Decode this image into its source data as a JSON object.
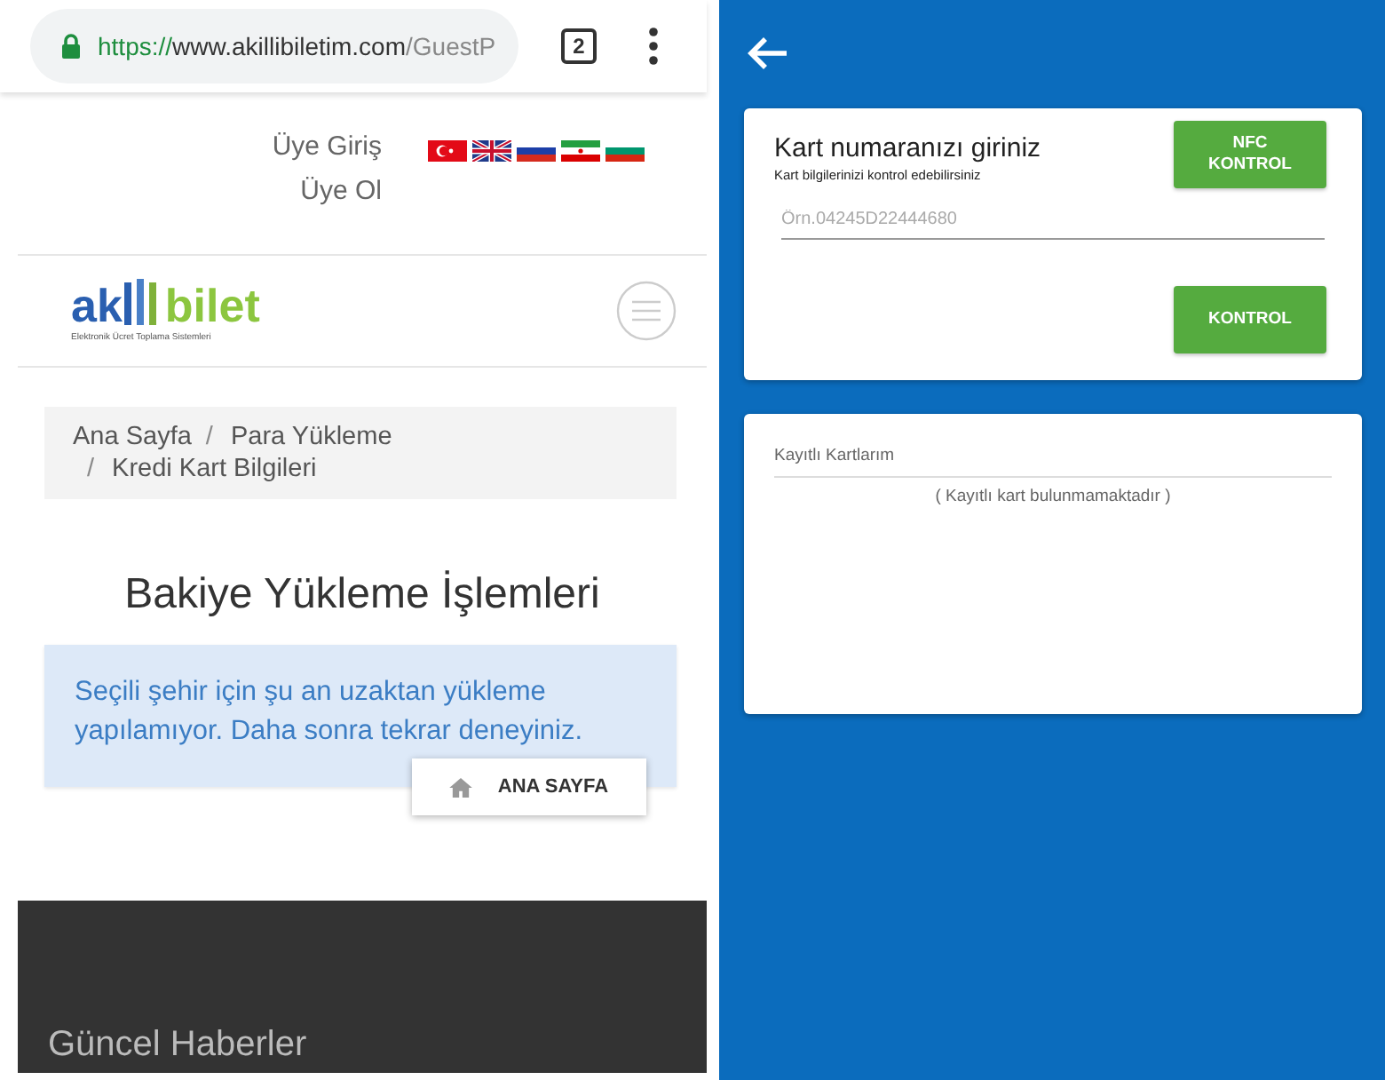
{
  "browser": {
    "url": {
      "scheme": "https://",
      "host": "www.akillibiletim.com",
      "path": "/GuestP"
    },
    "tab_count": "2"
  },
  "website": {
    "member_links": [
      "Üye Giriş",
      "Üye Ol"
    ],
    "logo": {
      "left": "ak",
      "right": "bilet",
      "tagline": "Elektronik Ücret Toplama Sistemleri"
    },
    "breadcrumb": [
      {
        "label": "Ana Sayfa"
      },
      {
        "separator": "/",
        "label": "Para Yükleme"
      },
      {
        "separator": "/",
        "label": "Kredi Kart Bilgileri"
      }
    ],
    "heading": "Bakiye Yükleme İşlemleri",
    "alert": "Seçili şehir için şu an uzaktan yükleme yapılamıyor. Daha sonra tekrar deneyiniz.",
    "home_button": "ANA SAYFA",
    "footer_title": "Güncel Haberler"
  },
  "app": {
    "card_entry": {
      "title": "Kart numaranızı giriniz",
      "subtitle": "Kart bilgilerinizi kontrol edebilirsiniz",
      "nfc_button": "NFC KONTROL",
      "placeholder": "Örn.04245D22444680",
      "check_button": "KONTROL"
    },
    "saved_cards": {
      "title": "Kayıtlı Kartlarım",
      "empty": "( Kayıtlı kart bulunmamaktadır )"
    }
  }
}
